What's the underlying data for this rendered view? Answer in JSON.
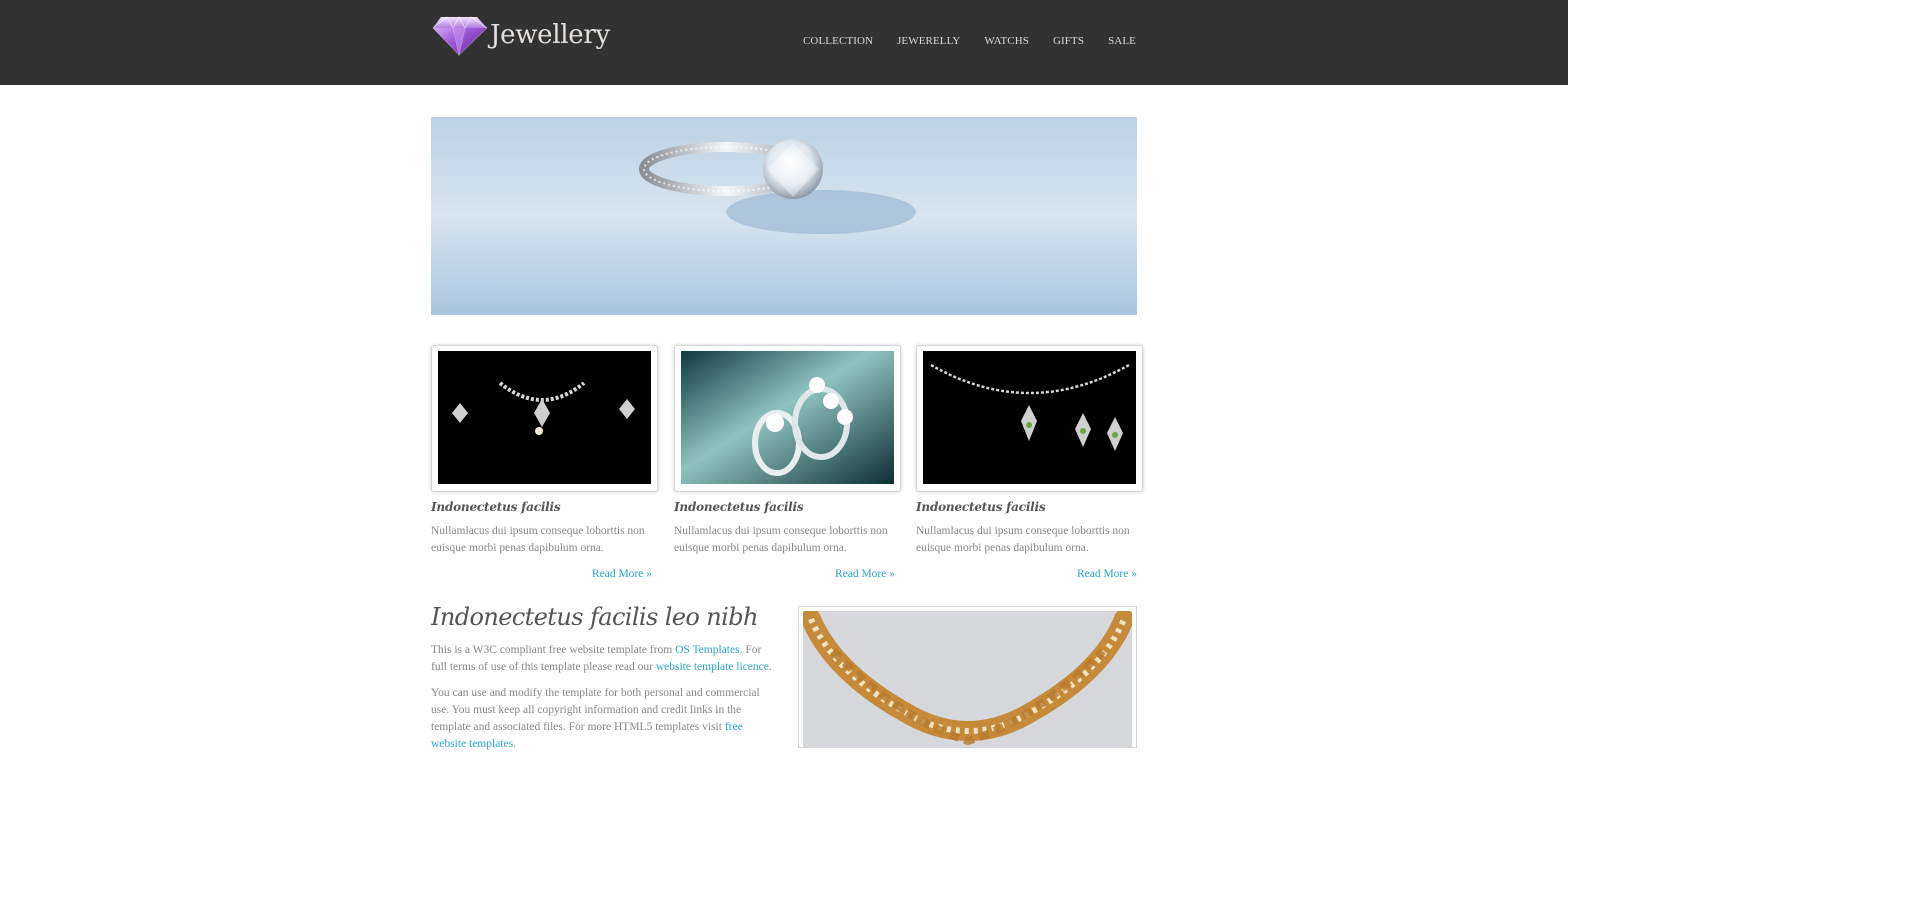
{
  "site": {
    "logo_text": "Jewellery",
    "logo_icon": "diamond-icon",
    "nav": [
      "COLLECTION",
      "JEWERELLY",
      "WATCHS",
      "GIFTS",
      "SALE"
    ]
  },
  "cards": [
    {
      "title": "Indonectetus facilis",
      "text": "Nullamlacus dui ipsum conseque loborttis non euisque morbi penas dapibulum orna.",
      "more": "Read More »"
    },
    {
      "title": "Indonectetus facilis",
      "text": "Nullamlacus dui ipsum conseque loborttis non euisque morbi penas dapibulum orna.",
      "more": "Read More »"
    },
    {
      "title": "Indonectetus facilis",
      "text": "Nullamlacus dui ipsum conseque loborttis non euisque morbi penas dapibulum orna.",
      "more": "Read More »"
    }
  ],
  "intro": {
    "heading": "Indonectetus facilis leo nibh",
    "p1_a": "This is a W3C compliant free website template from ",
    "p1_link1": "OS Templates",
    "p1_b": ". For full terms of use of this template please read our ",
    "p1_link2": "website template licence",
    "p1_c": ".",
    "p2_a": "You can use and modify the template for both personal and commercial use. You must keep all copyright information and credit links in the template and associated files. For more HTML5 templates visit ",
    "p2_link": "free website templates",
    "p2_b": "."
  },
  "colors": {
    "header_bg": "#323232",
    "link": "#2aa6c4",
    "nav_text": "#d9d9d9"
  }
}
